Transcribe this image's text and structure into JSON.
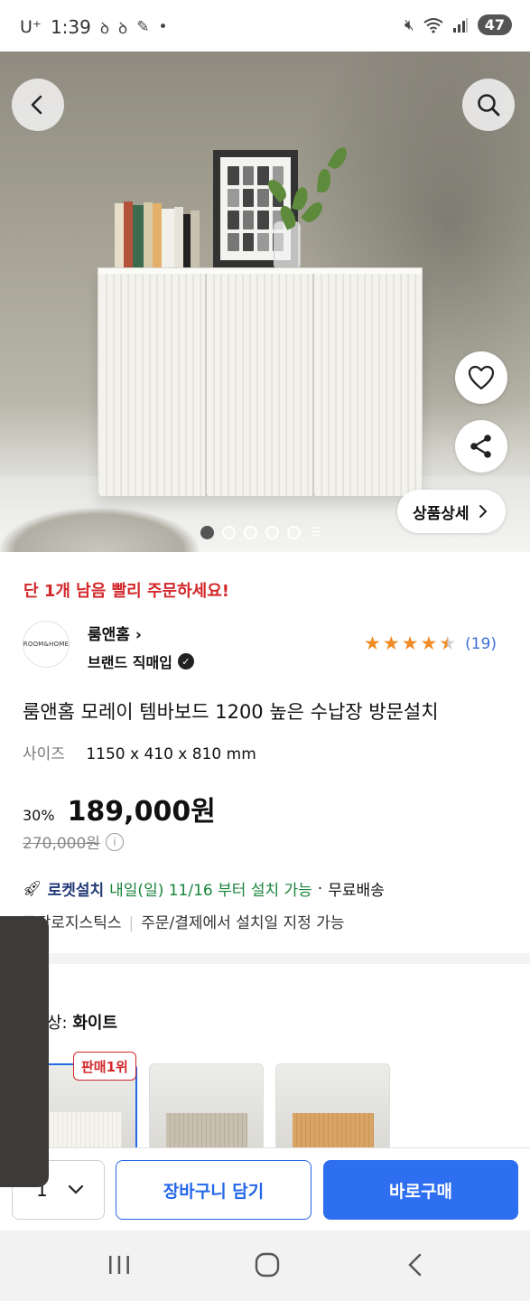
{
  "status_bar": {
    "carrier": "U⁺",
    "time": "1:39",
    "battery": "47"
  },
  "hero": {
    "detail_label": "상품상세",
    "image_count": 5,
    "active_image": 1
  },
  "notice": {
    "stock_alert": "단 1개 남음 빨리 주문하세요!"
  },
  "brand": {
    "logo_text": "ROOM&HOME",
    "name": "룸앤홈",
    "subtitle": "브랜드 직매입",
    "rating": 4.5,
    "review_count": "(19)"
  },
  "product": {
    "title": "룸앤홈 모레이 템바보드 1200 높은 수납장 방문설치",
    "size_label": "사이즈",
    "size_value": "1150 x 410 x 810 mm",
    "discount": "30%",
    "price": "189,000원",
    "original_price": "270,000원"
  },
  "delivery": {
    "badge": "로켓설치",
    "date_text": "내일(일) 11/16 부터 설치 가능",
    "dot": "·",
    "shipping": "무료배송",
    "logistics": "쿠팡로지스틱스",
    "install_note": "주문/결제에서 설치일 지정 가능"
  },
  "options": {
    "label_prefix": "상:",
    "selected_color": "화이트",
    "bestseller_badge": "판매1위"
  },
  "bottom_bar": {
    "quantity": "1",
    "cart_label": "장바구니 담기",
    "buy_label": "바로구매"
  },
  "colors": {
    "accent_blue": "#2e6ef0",
    "alert_red": "#d3272a",
    "delivery_green": "#18843a",
    "star_orange": "#f08c26"
  }
}
